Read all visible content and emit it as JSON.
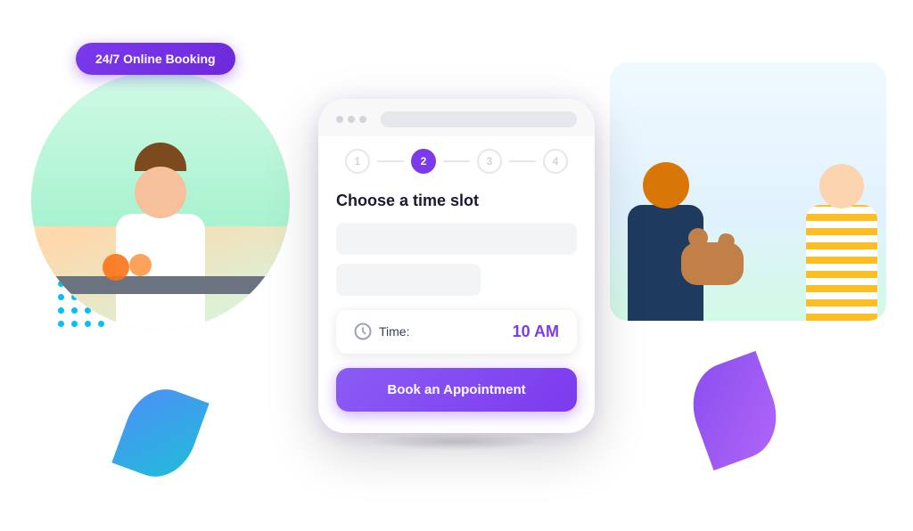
{
  "badge": {
    "text": "24/7 Online Booking"
  },
  "phone": {
    "step_active": "2",
    "step_1": "1",
    "step_2": "2",
    "step_3": "3",
    "step_4": "4",
    "title": "Choose a time slot",
    "time_label": "Time:",
    "time_value": "10 AM",
    "book_button": "Book an Appointment"
  },
  "decorations": {
    "ring_color": "#00e5c8",
    "leaf_right_color": "#7c3aed",
    "dot_color": "#00bfff"
  }
}
